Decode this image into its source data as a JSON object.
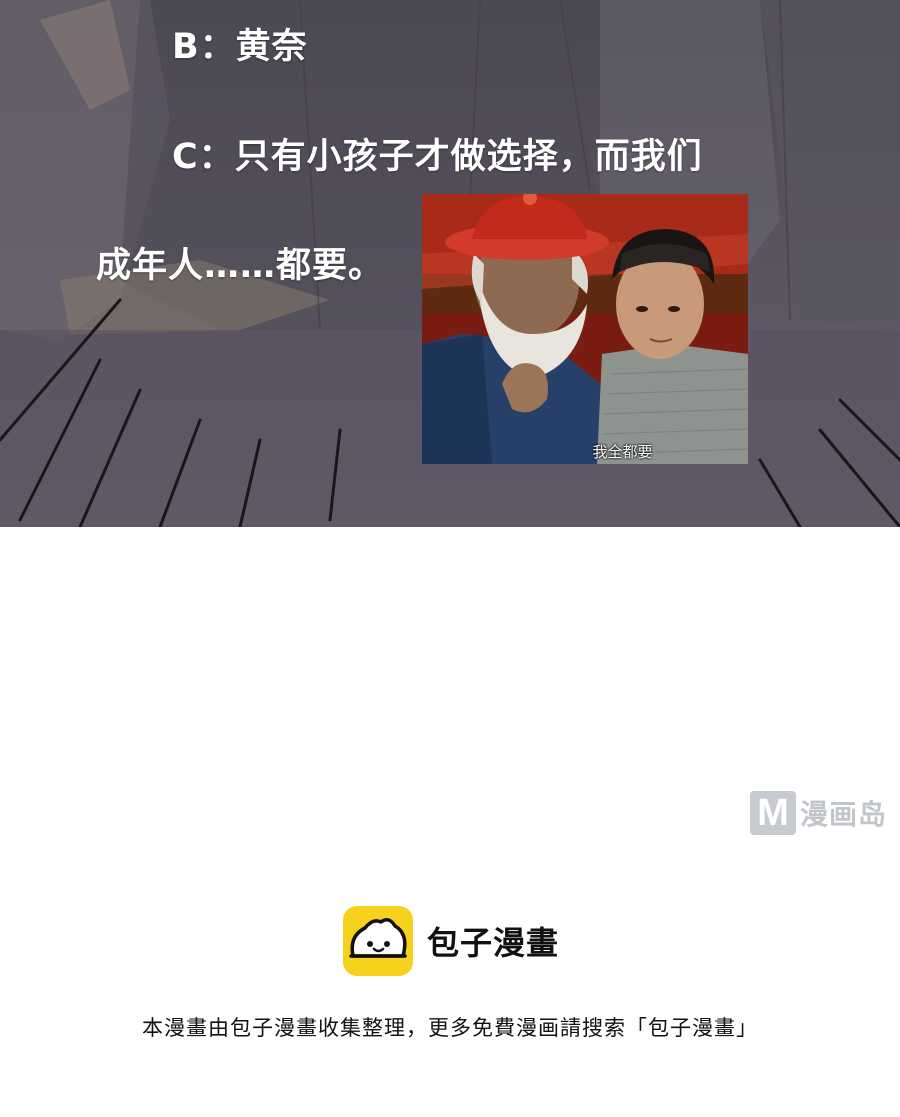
{
  "panel": {
    "option_b": "B：黄奈",
    "option_c_line1": "C：只有小孩子才做选择，而我们",
    "option_c_line2": "成年人……都要。",
    "meme_caption": "我全都要"
  },
  "watermark": {
    "logo_letter": "M",
    "site_name": "漫画岛"
  },
  "footer": {
    "brand_name": "包子漫畫",
    "note": "本漫畫由包子漫畫收集整理，更多免費漫画請搜索「包子漫畫」"
  },
  "colors": {
    "panel_bg": "#55505b",
    "brand_yellow": "#f7d21d",
    "watermark_gray": "#c7cbd0"
  }
}
